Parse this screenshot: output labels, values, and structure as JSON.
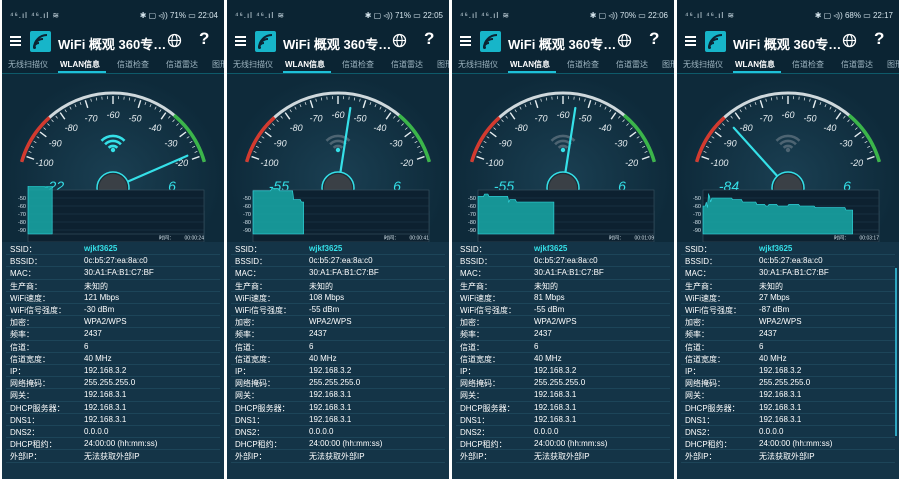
{
  "app": {
    "title": "WiFi 概观 360专…"
  },
  "colors": {
    "accent": "#35e0e8",
    "background": "#0e2a3a",
    "gaugeRed": "#d33a2f",
    "gaugeGreen": "#3bb54a",
    "chartFill": "#19a9a8"
  },
  "tabs": [
    "无线扫描仪",
    "WLAN信息",
    "信道检查",
    "信道雷达",
    "图形"
  ],
  "gauge": {
    "ticks": [
      "-100",
      "-90",
      "-80",
      "-70",
      "-60",
      "-50",
      "-40",
      "-30",
      "-20"
    ],
    "unit_label": "dBm",
    "channel_label": "无线频道"
  },
  "chart": {
    "yticks": [
      "-50",
      "-60",
      "-70",
      "-80",
      "-90"
    ],
    "time_prefix": "时间："
  },
  "info_keys": [
    "SSID：",
    "BSSID：",
    "MAC：",
    "生产商：",
    "WiFi速度：",
    "WiFi信号强度：",
    "加密：",
    "频率：",
    "信道：",
    "信道宽度：",
    "IP：",
    "网络掩码：",
    "网关：",
    "DHCP服务器：",
    "DNS1：",
    "DNS2：",
    "DHCP租约：",
    "外部IP："
  ],
  "screens": [
    {
      "status_left": "⁴⁶.ıl ⁴⁶.ıl ≋",
      "status_right": "✱ ▢ ◃)) 71% ▭ 22:04",
      "dbm": "-22",
      "channel": "6",
      "time": "00:00:24",
      "needle_dbm": -22,
      "wifi_bars": 4,
      "signal_history": [
        -35,
        -35,
        -35,
        -35,
        -35,
        -35,
        -35,
        -35,
        -35,
        -35,
        -35,
        -35,
        -35,
        -35,
        -35,
        -35,
        -34,
        -35,
        -35,
        -35,
        -35,
        -35,
        -35
      ],
      "info_values": [
        "wjkf3625",
        "0c:b5:27:ea:8a:c0",
        "30:A1:FA:B1:C7:BF",
        "未知的",
        "121 Mbps",
        "-30 dBm",
        "WPA2/WPS",
        "2437",
        "6",
        "40 MHz",
        "192.168.3.2",
        "255.255.255.0",
        "192.168.3.1",
        "192.168.3.1",
        "192.168.3.1",
        "0.0.0.0",
        "24:00:00 (hh:mm:ss)",
        "无法获取外部IP"
      ]
    },
    {
      "status_left": "⁴⁶.ıl ⁴⁶.ıl ≋",
      "status_right": "✱ ▢ ◃)) 71% ▭ 22:05",
      "dbm": "-55",
      "channel": "6",
      "time": "00:00:41",
      "needle_dbm": -55,
      "wifi_bars": 1,
      "signal_history": [
        -41,
        -41,
        -41,
        -41,
        -41,
        -41,
        -41,
        -41,
        -41,
        -41,
        -41,
        -41,
        -41,
        -41,
        -41,
        -41,
        -41,
        -38,
        -38,
        -38,
        -38,
        -38,
        -38,
        -38,
        -41,
        -41,
        -41,
        -41,
        -41,
        -41,
        -41,
        -41,
        -41,
        -41,
        -41,
        -41,
        -41,
        -52,
        -52,
        -52,
        -52,
        -52,
        -52,
        -52,
        -55,
        -55,
        -55
      ],
      "info_values": [
        "wjkf3625",
        "0c:b5:27:ea:8a:c0",
        "30:A1:FA:B1:C7:BF",
        "未知的",
        "108 Mbps",
        "-55 dBm",
        "WPA2/WPS",
        "2437",
        "6",
        "40 MHz",
        "192.168.3.2",
        "255.255.255.0",
        "192.168.3.1",
        "192.168.3.1",
        "192.168.3.1",
        "0.0.0.0",
        "24:00:00 (hh:mm:ss)",
        "无法获取外部IP"
      ]
    },
    {
      "status_left": "⁴⁶.ıl ⁴⁶.ıl ≋",
      "status_right": "✱ ▢ ◃)) 70% ▭ 22:06",
      "dbm": "-55",
      "channel": "6",
      "time": "00:01:09",
      "needle_dbm": -55,
      "wifi_bars": 1,
      "signal_history": [
        -48,
        -48,
        -48,
        -48,
        -48,
        -48,
        -45,
        -45,
        -45,
        -45,
        -48,
        -48,
        -48,
        -48,
        -48,
        -48,
        -48,
        -48,
        -48,
        -48,
        -48,
        -48,
        -48,
        -48,
        -48,
        -48,
        -48,
        -48,
        -55,
        -52,
        -52,
        -52,
        -52,
        -52,
        -52,
        -55,
        -55,
        -55,
        -55,
        -55,
        -55,
        -55,
        -55,
        -55,
        -55,
        -55,
        -55,
        -55,
        -55,
        -55,
        -55,
        -55,
        -55,
        -55,
        -55,
        -55,
        -55,
        -55,
        -55,
        -55,
        -55,
        -55,
        -55,
        -55,
        -55,
        -55,
        -55,
        -55,
        -55,
        -55
      ],
      "info_values": [
        "wjkf3625",
        "0c:b5:27:ea:8a:c0",
        "30:A1:FA:B1:C7:BF",
        "未知的",
        "81 Mbps",
        "-55 dBm",
        "WPA2/WPS",
        "2437",
        "6",
        "40 MHz",
        "192.168.3.2",
        "255.255.255.0",
        "192.168.3.1",
        "192.168.3.1",
        "192.168.3.1",
        "0.0.0.0",
        "24:00:00 (hh:mm:ss)",
        "无法获取外部IP"
      ]
    },
    {
      "status_left": "⁴⁶.ıl ⁴⁶.ıl ≋",
      "status_right": "✱ ▢ ◃)) 68% ▭ 22:17",
      "dbm": "-84",
      "channel": "6",
      "time": "00:03:17",
      "needle_dbm": -84,
      "wifi_bars": 0,
      "signal_history": [
        -60,
        -60,
        -60,
        -55,
        -62,
        -45,
        -48,
        -55,
        -50,
        -50,
        -50,
        -50,
        -50,
        -50,
        -50,
        -50,
        -50,
        -50,
        -50,
        -50,
        -50,
        -50,
        -50,
        -50,
        -50,
        -50,
        -50,
        -52,
        -52,
        -52,
        -52,
        -52,
        -52,
        -52,
        -52,
        -52,
        -55,
        -55,
        -55,
        -55,
        -55,
        -55,
        -55,
        -55,
        -55,
        -55,
        -55,
        -55,
        -55,
        -58,
        -58,
        -58,
        -58,
        -58,
        -58,
        -58,
        -58,
        -60,
        -60,
        -60,
        -58,
        -58,
        -58,
        -58,
        -58,
        -58,
        -58,
        -58,
        -60,
        -60,
        -60,
        -60,
        -60,
        -60,
        -60,
        -60,
        -60,
        -60,
        -58,
        -58,
        -58,
        -58,
        -58,
        -58,
        -58,
        -58,
        -58,
        -58,
        -60,
        -60,
        -60,
        -60,
        -60,
        -60,
        -60,
        -60,
        -60,
        -60,
        -60,
        -60,
        -60,
        -60,
        -62,
        -62,
        -62,
        -62,
        -62,
        -62,
        -62,
        -62,
        -62,
        -62,
        -62,
        -62,
        -62,
        -62,
        -62,
        -62,
        -62,
        -62,
        -62,
        -62,
        -62,
        -62,
        -62,
        -62,
        -62,
        -62,
        -62,
        -62,
        -65,
        -65,
        -65,
        -65,
        -65,
        -65,
        -65
      ],
      "info_values": [
        "wjkf3625",
        "0c:b5:27:ea:8a:c0",
        "30:A1:FA:B1:C7:BF",
        "未知的",
        "27 Mbps",
        "-87 dBm",
        "WPA2/WPS",
        "2437",
        "6",
        "40 MHz",
        "192.168.3.2",
        "255.255.255.0",
        "192.168.3.1",
        "192.168.3.1",
        "192.168.3.1",
        "0.0.0.0",
        "24:00:00 (hh:mm:ss)",
        "无法获取外部IP"
      ]
    }
  ]
}
